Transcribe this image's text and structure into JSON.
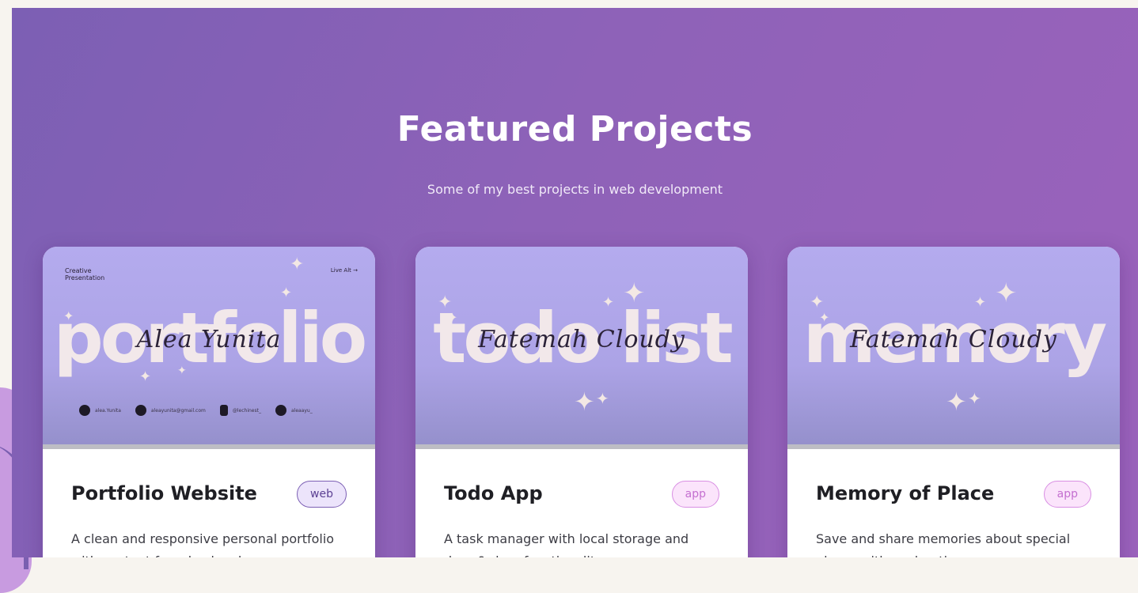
{
  "section": {
    "title": "Featured Projects",
    "subtitle": "Some of my best projects in web development"
  },
  "colors": {
    "gradient_start": "#7c5fb4",
    "gradient_end": "#9b62bc",
    "thumb_bg": "#b4abee",
    "tag_web": "#7c5fb4",
    "tag_app": "#d98fe3"
  },
  "projects": [
    {
      "title": "Portfolio Website",
      "tag": "web",
      "description": "A clean and responsive personal portfolio with content from backend",
      "thumb": {
        "word": "portfolio",
        "signature": "Alea Yunita",
        "mini_title": "Creative Presentation",
        "mini_link": "Live Alt →",
        "socials": [
          "alea.Yunita",
          "aleayunita@gmail.com",
          "@lechinest_",
          "aleaayu_"
        ],
        "social_icons": [
          "linkedin-icon",
          "email-icon",
          "tiktok-icon",
          "instagram-icon"
        ]
      }
    },
    {
      "title": "Todo App",
      "tag": "app",
      "description": "A task manager with local storage and drag & drop functionality",
      "thumb": {
        "word": "todo list",
        "signature": "Fatemah Cloudy"
      }
    },
    {
      "title": "Memory of Place",
      "tag": "app",
      "description": "Save and share memories about special places with exploration",
      "thumb": {
        "word": "memory",
        "signature": "Fatemah Cloudy"
      }
    }
  ]
}
